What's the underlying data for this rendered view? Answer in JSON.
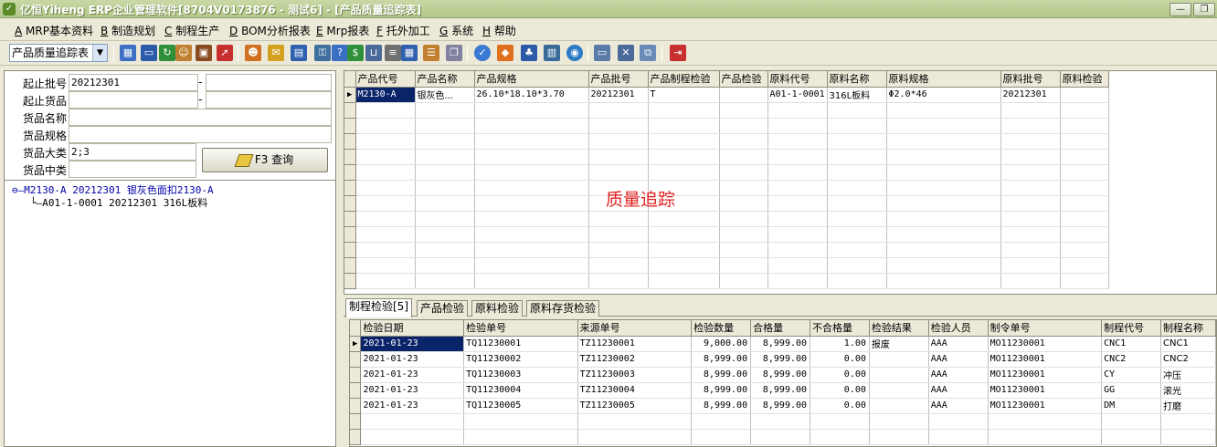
{
  "window": {
    "title": "亿恒Yiheng  ERP企业管理软件[8704V0173876 - 测试6] - [产品质量追踪表]",
    "minimize_glyph": "—",
    "restore_glyph": "❐"
  },
  "menu": [
    {
      "key": "A",
      "label": "MRP基本资料"
    },
    {
      "key": "B",
      "label": "制造规划"
    },
    {
      "key": "C",
      "label": "制程生产"
    },
    {
      "key": "D",
      "label": "BOM分析报表"
    },
    {
      "key": "E",
      "label": "Mrp报表"
    },
    {
      "key": "F",
      "label": "托外加工"
    },
    {
      "key": "G",
      "label": "系统"
    },
    {
      "key": "H",
      "label": "帮助"
    }
  ],
  "toolbar": {
    "report_selector": "产品质量追踪表",
    "icons": [
      "grid-icon",
      "monitor-icon",
      "refresh-icon",
      "users-icon",
      "briefcase-icon",
      "export-icon",
      "folder-users-icon",
      "mail-icon",
      "document-icon",
      "key-icon",
      "question-icon",
      "dollar-icon",
      "cart-icon",
      "list-icon",
      "calculator-icon",
      "database-icon",
      "copy-icon",
      "check-icon",
      "bell-icon",
      "tree-icon",
      "chart-icon",
      "globe-icon",
      "window-icon",
      "close-icon",
      "tile-icon",
      "exit-icon"
    ]
  },
  "query": {
    "start_batch_label": "起止批号",
    "start_batch_from": "20212301",
    "start_batch_to": "",
    "start_goods_label": "起止货品",
    "start_goods_from": "",
    "start_goods_to": "",
    "goods_name_label": "货品名称",
    "goods_name": "",
    "goods_spec_label": "货品规格",
    "goods_spec": "",
    "category_major_label": "货品大类",
    "category_major": "2;3",
    "category_mid_label": "货品中类",
    "category_mid": "",
    "range_sep": "-",
    "query_button": "F3 查询"
  },
  "tree": {
    "root": "M2130-A 20212301 银灰色面扣2130-A",
    "child": "A01-1-0001 20212301 316L板料"
  },
  "top_grid": {
    "columns": [
      "产品代号",
      "产品名称",
      "产品规格",
      "产品批号",
      "产品制程检验",
      "产品检验",
      "原料代号",
      "原料名称",
      "原料规格",
      "原料批号",
      "原料检验"
    ],
    "rows": [
      [
        "M2130-A",
        "银灰色...",
        "26.10*18.10*3.70",
        "20212301",
        "T",
        "",
        "A01-1-0001",
        "316L板料",
        "Φ2.0*46",
        "20212301",
        ""
      ]
    ]
  },
  "watermark": "质量追踪",
  "tabs": [
    "制程检验[5]",
    "产品检验",
    "原料检验",
    "原料存货检验"
  ],
  "bottom_grid": {
    "columns": [
      "检验日期",
      "检验单号",
      "来源单号",
      "检验数量",
      "合格量",
      "不合格量",
      "检验结果",
      "检验人员",
      "制令单号",
      "制程代号",
      "制程名称"
    ],
    "rows": [
      [
        "2021-01-23",
        "TQ11230001",
        "TZ11230001",
        "9,000.00",
        "8,999.00",
        "1.00",
        "报废",
        "AAA",
        "MO11230001",
        "CNC1",
        "CNC1"
      ],
      [
        "2021-01-23",
        "TQ11230002",
        "TZ11230002",
        "8,999.00",
        "8,999.00",
        "0.00",
        "",
        "AAA",
        "MO11230001",
        "CNC2",
        "CNC2"
      ],
      [
        "2021-01-23",
        "TQ11230003",
        "TZ11230003",
        "8,999.00",
        "8,999.00",
        "0.00",
        "",
        "AAA",
        "MO11230001",
        "CY",
        "冲压"
      ],
      [
        "2021-01-23",
        "TQ11230004",
        "TZ11230004",
        "8,999.00",
        "8,999.00",
        "0.00",
        "",
        "AAA",
        "MO11230001",
        "GG",
        "滚光"
      ],
      [
        "2021-01-23",
        "TQ11230005",
        "TZ11230005",
        "8,999.00",
        "8,999.00",
        "0.00",
        "",
        "AAA",
        "MO11230001",
        "DM",
        "打磨"
      ]
    ]
  }
}
